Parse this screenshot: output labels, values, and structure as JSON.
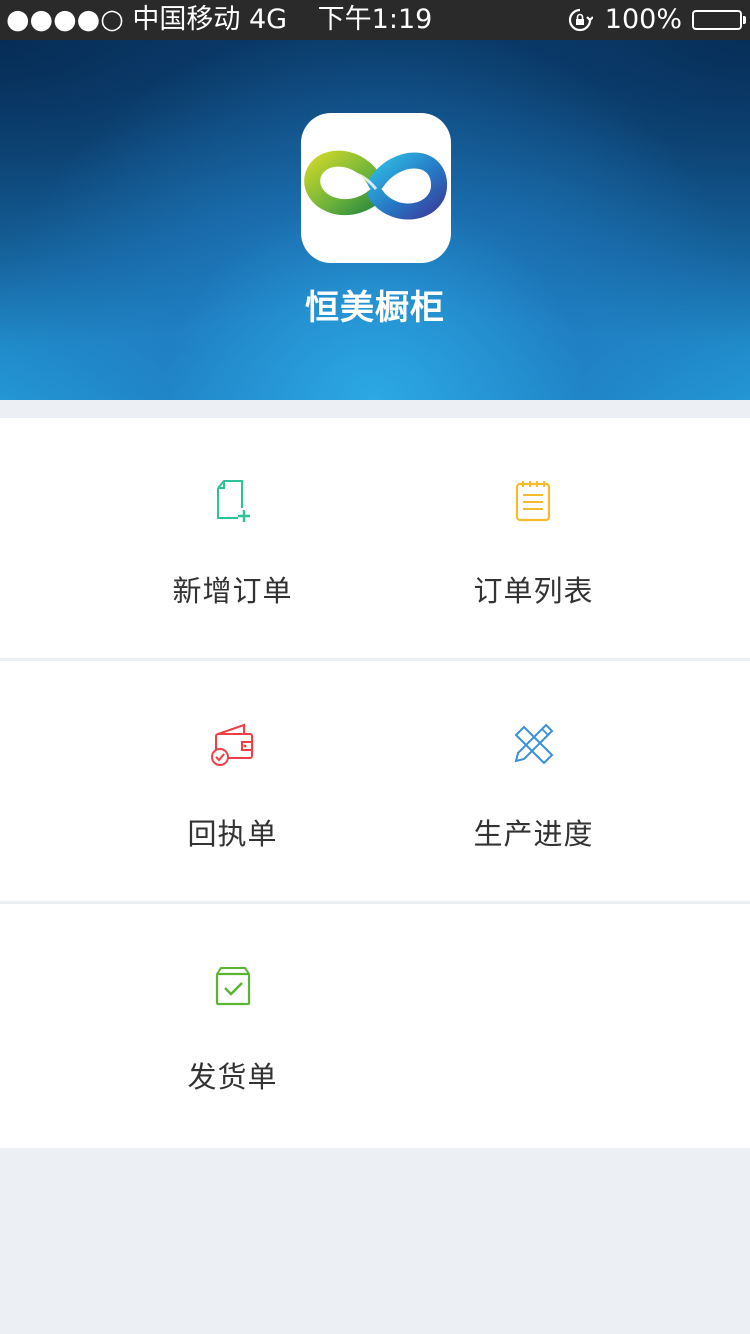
{
  "status_bar": {
    "carrier": "●●●●○ 中国移动  4G",
    "time": "下午1:19",
    "battery": "100%"
  },
  "header": {
    "app_name": "恒美橱柜",
    "logo_icon": "infinity-logo-icon"
  },
  "menu": {
    "items": [
      {
        "label": "新增订单",
        "icon": "new-document-icon",
        "color": "#2ec29a"
      },
      {
        "label": "订单列表",
        "icon": "notepad-list-icon",
        "color": "#f6bc2c"
      },
      {
        "label": "回执单",
        "icon": "wallet-check-icon",
        "color": "#ef3e45"
      },
      {
        "label": "生产进度",
        "icon": "ruler-pencil-icon",
        "color": "#3b8fe0"
      },
      {
        "label": "发货单",
        "icon": "box-check-icon",
        "color": "#5bb432"
      }
    ]
  }
}
